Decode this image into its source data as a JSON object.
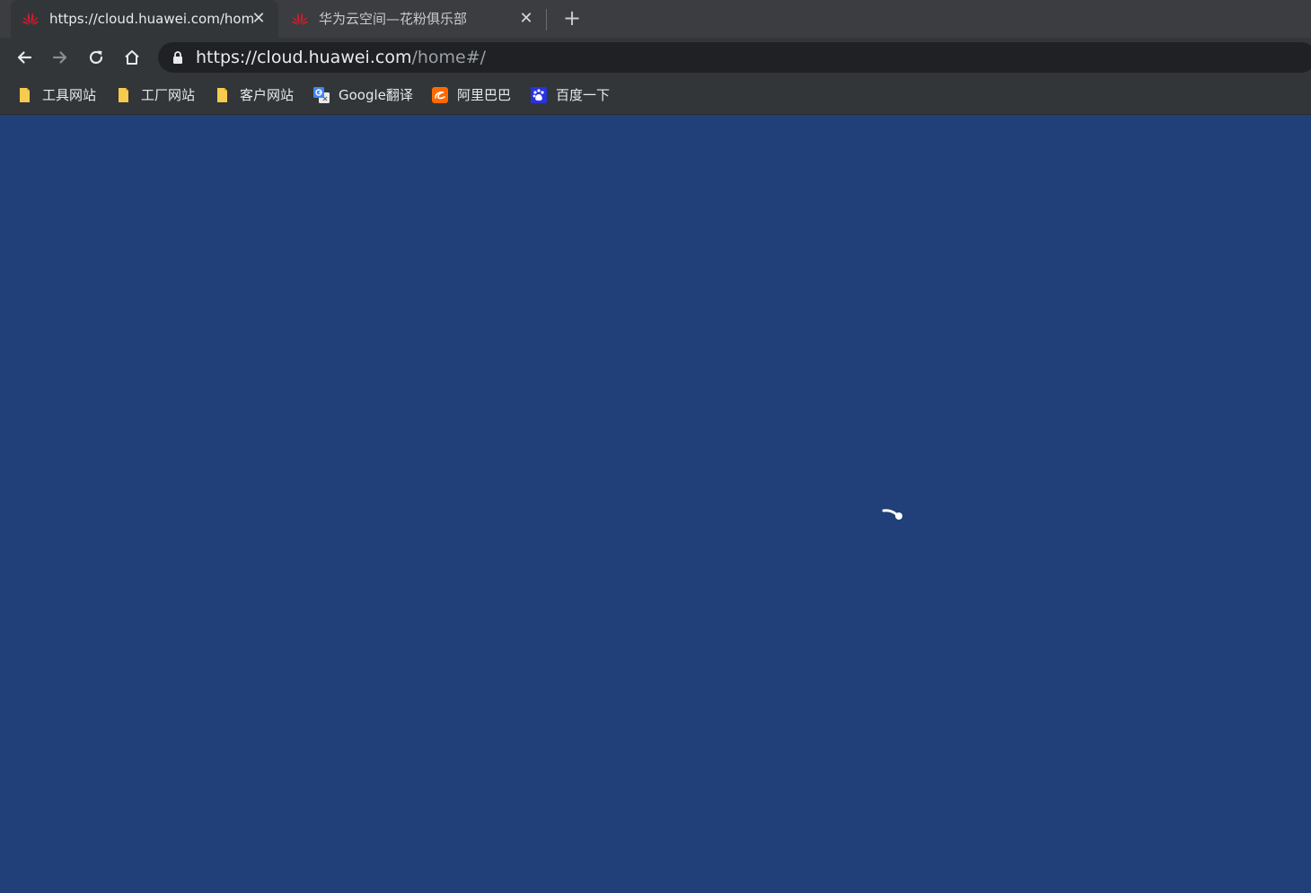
{
  "tabs": [
    {
      "title": "https://cloud.huawei.com/home#/",
      "active": true
    },
    {
      "title": "华为云空间—花粉俱乐部",
      "active": false
    }
  ],
  "tab_close_glyph": "✕",
  "new_tab_glyph": "+",
  "omnibox": {
    "url_main": "https://cloud.huawei.com",
    "url_path": "/home#/"
  },
  "bookmarks": [
    {
      "label": "工具网站",
      "icon": "folder-icon"
    },
    {
      "label": "工厂网站",
      "icon": "folder-icon"
    },
    {
      "label": "客户网站",
      "icon": "folder-icon"
    },
    {
      "label": "Google翻译",
      "icon": "google-translate-icon"
    },
    {
      "label": "阿里巴巴",
      "icon": "alibaba-icon"
    },
    {
      "label": "百度一下",
      "icon": "baidu-icon"
    }
  ],
  "colors": {
    "page_background": "#213f78",
    "huawei_red": "#cf1d2c",
    "folder_yellow": "#f7cb4d",
    "alibaba_orange": "#ff6a00",
    "baidu_blue": "#2932e1"
  }
}
